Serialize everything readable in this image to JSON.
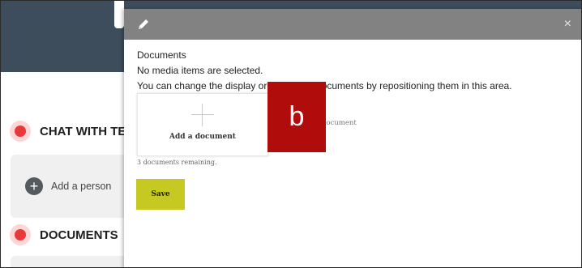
{
  "background": {
    "sections": [
      {
        "label": "CHAT WITH TE"
      },
      {
        "label": "DOCUMENTS"
      }
    ],
    "add_person_label": "Add a person"
  },
  "modal": {
    "title_icon": "pencil-icon",
    "close_label": "×",
    "heading": "Documents",
    "no_items_text": "No media items are selected.",
    "reposition_text": "You can change the display order of your documents by repositioning them in this area.",
    "add_document_label": "Add a document",
    "doc_hint": "document",
    "remaining_text": "3 documents remaining.",
    "save_label": "Save"
  },
  "overlay_label": "b",
  "colors": {
    "header": "#3d4d5b",
    "modal_header": "#828282",
    "save": "#c6c921",
    "overlay": "#b00c0c",
    "record": "#e83a3a"
  }
}
